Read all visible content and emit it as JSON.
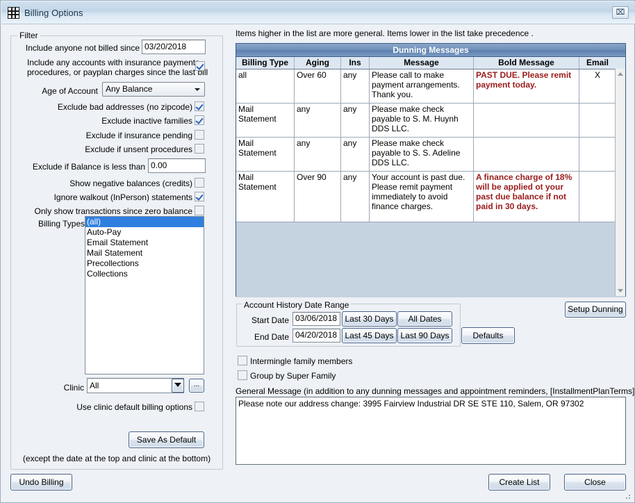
{
  "window": {
    "title": "Billing Options",
    "close_label": "⌧",
    "icon": "grid-icon"
  },
  "filter": {
    "legend": "Filter",
    "not_billed_since_label": "Include anyone not billed since",
    "not_billed_since_value": "03/20/2018",
    "include_accounts_label_line1": "Include any accounts with insurance payments,",
    "include_accounts_label_line2": "procedures, or payplan charges since the last bill",
    "include_accounts_checked": true,
    "age_of_account_label": "Age of Account",
    "age_of_account_value": "Any Balance",
    "exclude_bad_addresses_label": "Exclude bad addresses (no zipcode)",
    "exclude_bad_addresses_checked": true,
    "exclude_inactive_label": "Exclude inactive families",
    "exclude_inactive_checked": true,
    "exclude_ins_pending_label": "Exclude if insurance pending",
    "exclude_ins_pending_checked": false,
    "exclude_unsent_label": "Exclude if unsent procedures",
    "exclude_unsent_checked": false,
    "exclude_balance_label": "Exclude if Balance is less than",
    "exclude_balance_value": "0.00",
    "show_negative_label": "Show negative balances (credits)",
    "show_negative_checked": false,
    "ignore_walkout_label": "Ignore walkout (InPerson) statements",
    "ignore_walkout_checked": true,
    "only_show_zero_label": "Only show transactions since zero balance",
    "only_show_zero_checked": false,
    "billing_types_label": "Billing Types",
    "billing_types": [
      {
        "label": "(all)",
        "selected": true
      },
      {
        "label": "Auto-Pay",
        "selected": false
      },
      {
        "label": "Email Statement",
        "selected": false
      },
      {
        "label": "Mail Statement",
        "selected": false
      },
      {
        "label": "Precollections",
        "selected": false
      },
      {
        "label": "Collections",
        "selected": false
      }
    ],
    "clinic_label": "Clinic",
    "clinic_value": "All",
    "clinic_ellipsis_label": "...",
    "use_clinic_defaults_label": "Use clinic default billing options",
    "use_clinic_defaults_checked": false,
    "save_as_default_label": "Save As Default",
    "save_note": "(except the date at the top and clinic at the bottom)"
  },
  "undo_billing_label": "Undo Billing",
  "dunning": {
    "hint": "Items higher in the list are more general.  Items lower in the list take precedence .",
    "title": "Dunning Messages",
    "columns": [
      "Billing Type",
      "Aging",
      "Ins",
      "Message",
      "Bold Message",
      "Email"
    ],
    "rows": [
      {
        "billing_type": "all",
        "aging": "Over 60",
        "ins": "any",
        "message": "Please call to make payment arrangements. Thank you.",
        "bold_message": "PAST DUE. Please remit payment today.",
        "email": "X"
      },
      {
        "billing_type": "Mail Statement",
        "aging": "any",
        "ins": "any",
        "message": "Please make check payable to S. M. Huynh DDS LLC.",
        "bold_message": "",
        "email": ""
      },
      {
        "billing_type": "Mail Statement",
        "aging": "any",
        "ins": "any",
        "message": "Please make check payable to S. S. Adeline DDS LLC.",
        "bold_message": "",
        "email": ""
      },
      {
        "billing_type": "Mail Statement",
        "aging": "Over 90",
        "ins": "any",
        "message": "Your account is past due. Please remit payment immediately to avoid finance charges.",
        "bold_message": "A finance charge of 18% will be applied ot your past due balance if not paid in 30 days.",
        "email": ""
      }
    ],
    "setup_dunning_label": "Setup Dunning"
  },
  "date_range": {
    "legend": "Account History Date Range",
    "start_label": "Start Date",
    "start_value": "03/06/2018",
    "end_label": "End Date",
    "end_value": "04/20/2018",
    "btn_last30": "Last 30 Days",
    "btn_all_dates": "All Dates",
    "btn_last45": "Last 45 Days",
    "btn_last90": "Last 90 Days",
    "btn_defaults": "Defaults"
  },
  "options": {
    "intermingle_label": "Intermingle family members",
    "intermingle_checked": false,
    "group_super_label": "Group by Super Family",
    "group_super_checked": false
  },
  "general_message": {
    "label": "General Message (in addition to any dunning messages and appointment reminders, [InstallmentPlanTerms] allowed)",
    "value": "Please note our address change: 3995 Fairview Industrial DR SE STE 110, Salem, OR 97302"
  },
  "footer": {
    "create_list_label": "Create List",
    "close_label": "Close"
  }
}
